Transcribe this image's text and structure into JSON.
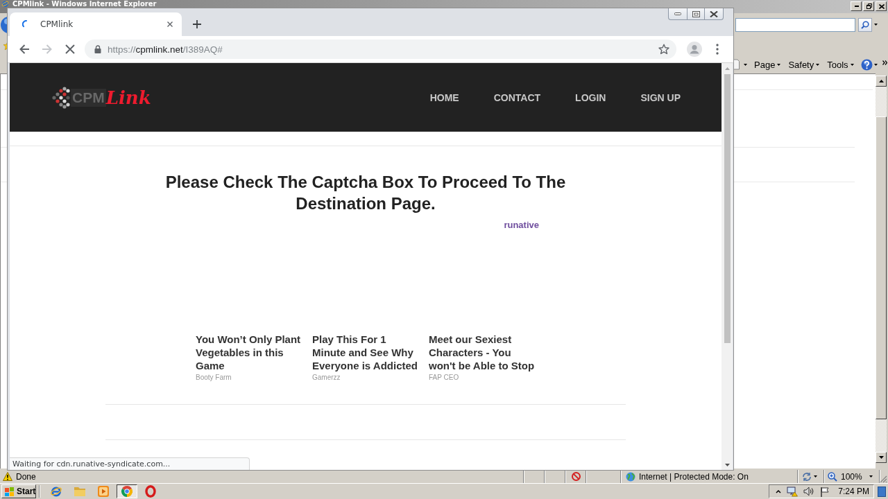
{
  "ie_window": {
    "title": "CPMlink - Windows Internet Explorer",
    "command_bar": [
      {
        "label": "Page"
      },
      {
        "label": "Safety"
      },
      {
        "label": "Tools"
      }
    ],
    "status_bar": {
      "status": "Done",
      "zone": "Internet | Protected Mode: On",
      "zoom": "100%"
    }
  },
  "chrome_window": {
    "loading": true,
    "tab": {
      "title": "CPMlink"
    },
    "toolbar": {
      "back_disabled": false,
      "forward_disabled": true
    },
    "address": {
      "scheme": "https://",
      "host": "cpmlink.net",
      "path": "/I389AQ#"
    },
    "page": {
      "logo": {
        "mark": "CPM",
        "script": "Link"
      },
      "nav": [
        {
          "label": "HOME"
        },
        {
          "label": "CONTACT"
        },
        {
          "label": "LOGIN"
        },
        {
          "label": "SIGN UP"
        }
      ],
      "heading": "Please Check The Captcha Box To Proceed To The Destination Page.",
      "ad_network": "runative",
      "ads": [
        {
          "title": "You Won’t Only Plant Vegetables in this Game",
          "source": "Booty Farm"
        },
        {
          "title": "Play This For 1 Minute and See Why Everyone is Addicted",
          "source": "Gamerzz"
        },
        {
          "title": "Meet our Sexiest Characters - You won't be Able to Stop",
          "source": "FAP CEO"
        }
      ]
    },
    "status_bubble": "Waiting for cdn.runative-syndicate.com..."
  },
  "taskbar": {
    "start": "Start",
    "items": [
      {
        "kind": "explorer",
        "selected": false
      },
      {
        "kind": "folder",
        "selected": false
      },
      {
        "kind": "player",
        "selected": false
      },
      {
        "kind": "chrome",
        "selected": true
      },
      {
        "kind": "opera",
        "selected": false
      }
    ],
    "clock": "7:24 PM"
  }
}
